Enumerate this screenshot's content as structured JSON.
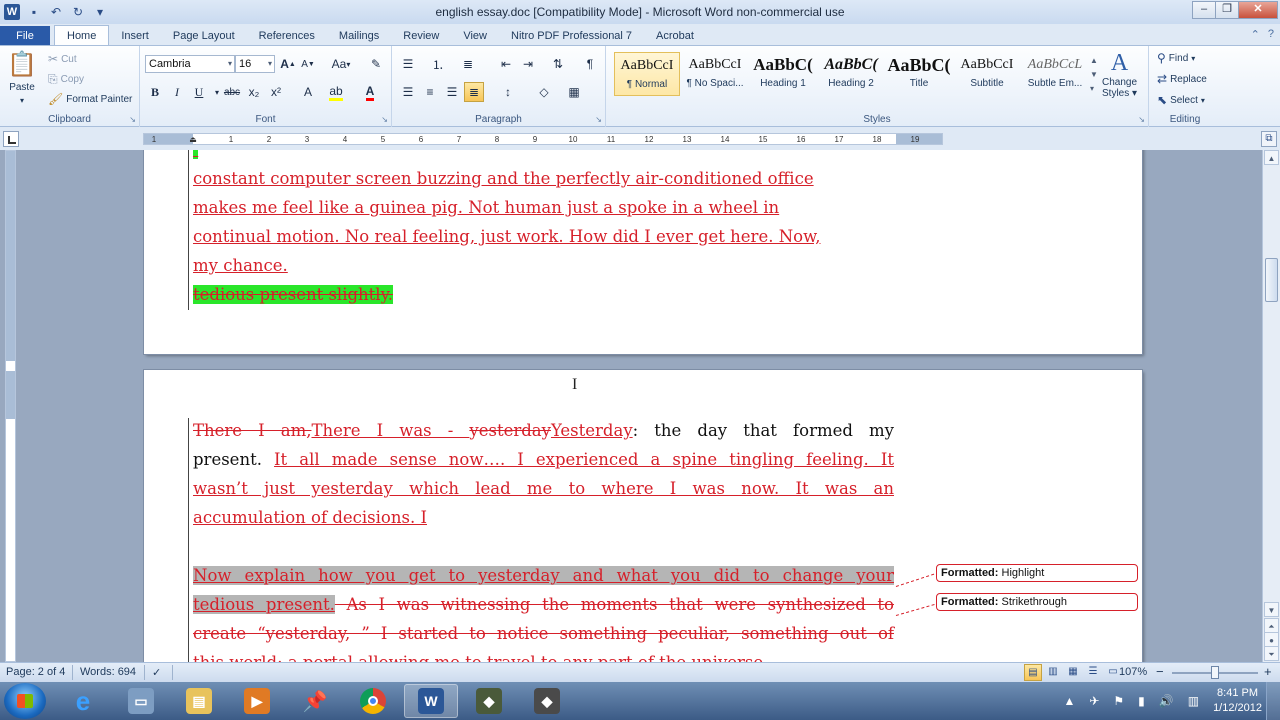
{
  "window": {
    "title": "english essay.doc [Compatibility Mode] - Microsoft Word non-commercial use",
    "undo_icon": "undo-icon",
    "redo_icon": "redo-icon",
    "save_icon": "save-icon"
  },
  "tabs": [
    "File",
    "Home",
    "Insert",
    "Page Layout",
    "References",
    "Mailings",
    "Review",
    "View",
    "Nitro PDF Professional 7",
    "Acrobat"
  ],
  "clipboard": {
    "paste": "Paste",
    "cut": "Cut",
    "copy": "Copy",
    "format_painter": "Format Painter",
    "label": "Clipboard"
  },
  "font": {
    "name": "Cambria",
    "size": "16",
    "label": "Font",
    "bold": "B",
    "italic": "I",
    "underline": "U",
    "strike": "abc",
    "sub": "x₂",
    "sup": "x²",
    "case": "Aa",
    "grow": "A",
    "shrink": "A"
  },
  "paragraph": {
    "label": "Paragraph",
    "pilcrow": "¶"
  },
  "styles": {
    "label": "Styles",
    "items": [
      {
        "preview": "AaBbCcI",
        "name": "¶ Normal"
      },
      {
        "preview": "AaBbCcI",
        "name": "¶ No Spaci..."
      },
      {
        "preview": "AaBbC(",
        "name": "Heading 1"
      },
      {
        "preview": "AaBbC(",
        "name": "Heading 2"
      },
      {
        "preview": "AaBbC(",
        "name": "Title"
      },
      {
        "preview": "AaBbCcI",
        "name": "Subtitle"
      },
      {
        "preview": "AaBbCcL",
        "name": "Subtle Em..."
      }
    ],
    "change_styles_line1": "Change",
    "change_styles_line2": "Styles"
  },
  "editing": {
    "label": "Editing",
    "find": "Find",
    "replace": "Replace",
    "select": "Select"
  },
  "ruler": {
    "ticks": [
      "1",
      "1",
      "2",
      "3",
      "4",
      "5",
      "6",
      "7",
      "8",
      "9",
      "10",
      "11",
      "12",
      "13",
      "14",
      "15",
      "16",
      "17",
      "18",
      "19"
    ]
  },
  "page1": {
    "l1": "constant computer screen buzzing and the perfectly air-conditioned office",
    "l2": "makes me feel like a guinea pig.  Not human just a spoke in a wheel in",
    "l3": "continual motion.  No real feeling, just work.  How did I ever get here.  Now,",
    "l4": "my chance.",
    "l5": " tedious present slightly."
  },
  "page2": {
    "del1": "There I am,",
    "ins1": "There I was - ",
    "del2": "yesterday",
    "ins2": "Yesterday",
    "plain1": ": the day that formed my",
    "plain2": "present. ",
    "ins3": " It all made sense now…. I experienced a spine tingling feeling.  It",
    "ins4": "wasn’t just yesterday which lead me to where I was now.   It was an",
    "ins5": "accumulation of decisions.  I",
    "hl1": "Now explain how you get to yesterday and what you did to change your",
    "hl2": "tedious present.",
    "del3": " As I was witnessing the moments that were synthesized to",
    "del4": "create “yesterday, ” I started to notice something peculiar, something out of",
    "del5": "this world; a  portal allowing me to travel to any part of the universe"
  },
  "balloons": [
    {
      "label": "Formatted:",
      "value": "Highlight"
    },
    {
      "label": "Formatted:",
      "value": "Strikethrough"
    }
  ],
  "status": {
    "page": "Page: 2 of 4",
    "words": "Words: 694",
    "zoom": "107%",
    "zoom_minus": "−",
    "zoom_plus": "+"
  },
  "clock": {
    "time": "8:41 PM",
    "date": "1/12/2012"
  }
}
